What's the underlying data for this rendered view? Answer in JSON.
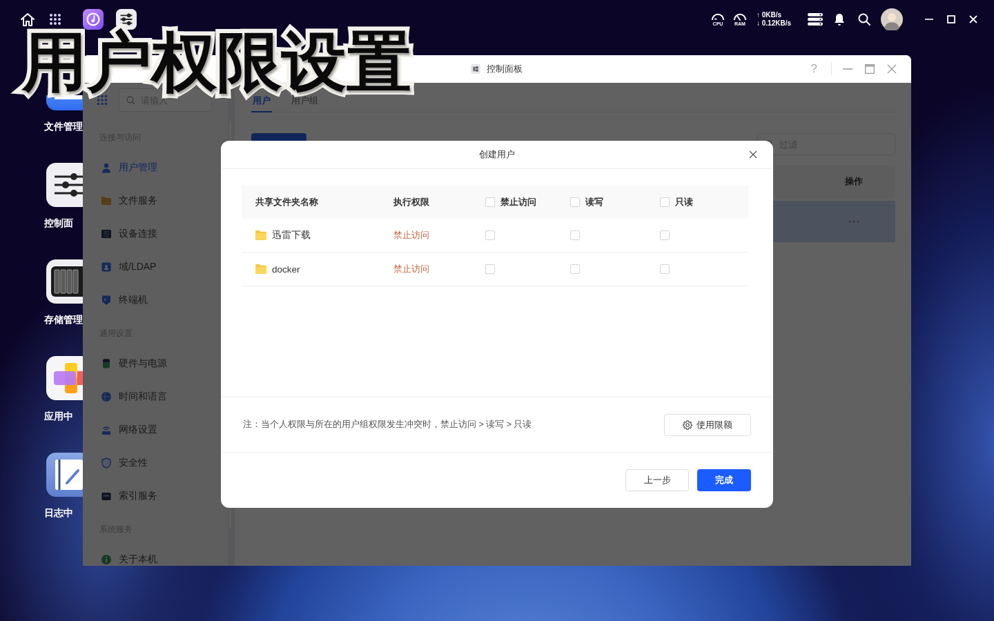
{
  "caption": "用户权限设置",
  "monitor": {
    "cpu": {
      "label": "CPU"
    },
    "ram": {
      "label": "RAM"
    },
    "upload": "↑ 0KB/s",
    "download": "↓ 0.12KB/s"
  },
  "desktop_icons": [
    {
      "label": "文件管理",
      "kind": "files"
    },
    {
      "label": "控制面",
      "kind": "control"
    },
    {
      "label": "存储管理",
      "kind": "storage"
    },
    {
      "label": "应用中",
      "kind": "apps"
    },
    {
      "label": "日志中",
      "kind": "log"
    }
  ],
  "window": {
    "title": "控制面板",
    "help": "?"
  },
  "sidebar": {
    "search": {
      "placeholder": "请输入"
    },
    "groups": [
      {
        "title": "连接与访问",
        "items": [
          {
            "label": "用户管理",
            "selected": true,
            "kind": "user"
          },
          {
            "label": "文件服务",
            "selected": false,
            "kind": "folder"
          },
          {
            "label": "设备连接",
            "selected": false,
            "kind": "device"
          },
          {
            "label": "域/LDAP",
            "selected": false,
            "kind": "domain"
          },
          {
            "label": "终端机",
            "selected": false,
            "kind": "terminal"
          }
        ]
      },
      {
        "title": "通用设置",
        "items": [
          {
            "label": "硬件与电源",
            "selected": false,
            "kind": "hardware"
          },
          {
            "label": "时间和语言",
            "selected": false,
            "kind": "globe"
          },
          {
            "label": "网络设置",
            "selected": false,
            "kind": "network"
          },
          {
            "label": "安全性",
            "selected": false,
            "kind": "shield"
          },
          {
            "label": "索引服务",
            "selected": false,
            "kind": "index"
          }
        ]
      },
      {
        "title": "系统服务",
        "items": [
          {
            "label": "关于本机",
            "selected": false,
            "kind": "info"
          }
        ]
      }
    ]
  },
  "main": {
    "tabs": [
      {
        "label": "用户",
        "selected": true
      },
      {
        "label": "用户组",
        "selected": false
      }
    ],
    "filter": {
      "placeholder": "过滤"
    },
    "table": {
      "columns": [
        {
          "label": "操作"
        }
      ],
      "rows": [
        {
          "selected": true
        }
      ]
    }
  },
  "dialog": {
    "title": "创建用户",
    "table": {
      "columns": [
        {
          "label": "共享文件夹名称",
          "kind": "text"
        },
        {
          "label": "执行权限",
          "kind": "text"
        },
        {
          "label": "禁止访问",
          "kind": "checkbox",
          "checked": false
        },
        {
          "label": "读写",
          "kind": "checkbox",
          "checked": false
        },
        {
          "label": "只读",
          "kind": "checkbox",
          "checked": false
        }
      ],
      "rows": [
        {
          "name": "迅雷下载",
          "permission": "禁止访问",
          "checks": [
            {
              "checked": false
            },
            {
              "checked": false
            },
            {
              "checked": false
            }
          ]
        },
        {
          "name": "docker",
          "permission": "禁止访问",
          "checks": [
            {
              "checked": false
            },
            {
              "checked": false
            },
            {
              "checked": false
            }
          ]
        }
      ]
    },
    "note": "注：当个人权限与所在的用户组权限发生冲突时，禁止访问 > 读写 > 只读",
    "quota_button": {
      "label": "使用限额"
    },
    "buttons": [
      {
        "label": "上一步",
        "kind": "secondary"
      },
      {
        "label": "完成",
        "kind": "primary"
      }
    ]
  }
}
